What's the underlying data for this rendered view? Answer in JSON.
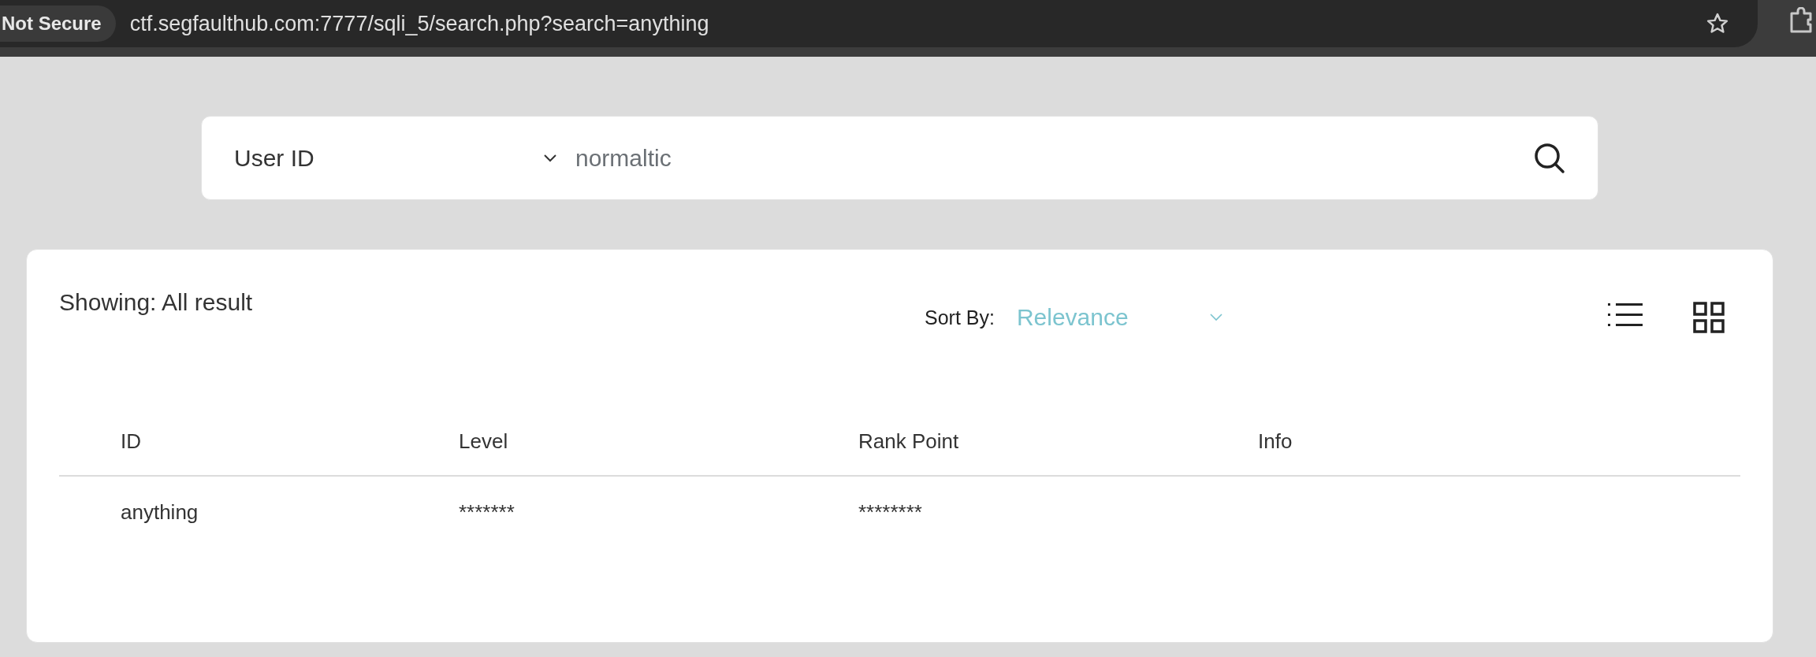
{
  "browser": {
    "security_label": "Not Secure",
    "url": "ctf.segfaulthub.com:7777/sqli_5/search.php?search=anything"
  },
  "search": {
    "category": "User ID",
    "value": "normaltic"
  },
  "results": {
    "showing": "Showing: All result",
    "sort_label": "Sort By:",
    "sort_value": "Relevance",
    "table": {
      "columns": [
        "ID",
        "Level",
        "Rank Point",
        "Info"
      ],
      "rows": [
        [
          "anything",
          "*******",
          "********"
        ]
      ]
    }
  }
}
